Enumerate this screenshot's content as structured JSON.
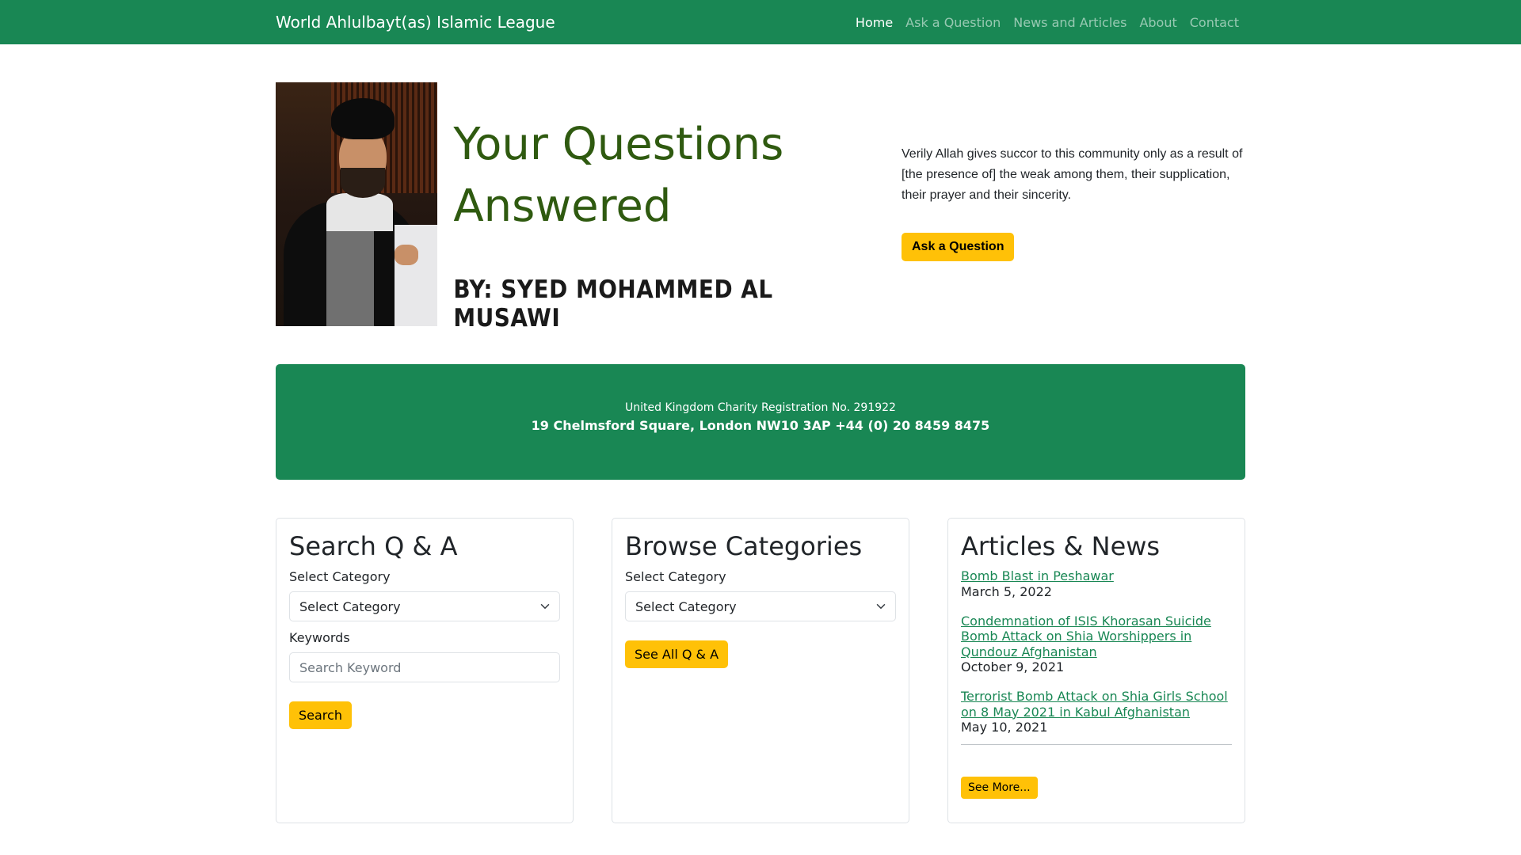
{
  "nav": {
    "brand": "World Ahlulbayt(as) Islamic League",
    "links": [
      "Home",
      "Ask a Question",
      "News and Articles",
      "About",
      "Contact"
    ]
  },
  "hero": {
    "title_line1": "Your Questions",
    "title_line2": "Answered",
    "byline": "BY: SYED MOHAMMED AL MUSAWI",
    "quote": "Verily Allah gives succor to this community only as a result of [the presence of] the weak among them, their supplication, their prayer and their sincerity.",
    "ask_button": "Ask a Question"
  },
  "info": {
    "registration": "United Kingdom Charity Registration No. 291922",
    "address": "19 Chelmsford Square, London NW10 3AP +44 (0) 20 8459 8475"
  },
  "search_card": {
    "title": "Search Q & A",
    "category_label": "Select Category",
    "category_value": "Select Category",
    "keywords_label": "Keywords",
    "keyword_placeholder": "Search Keyword",
    "button": "Search"
  },
  "browse_card": {
    "title": "Browse Categories",
    "category_label": "Select Category",
    "category_value": "Select Category",
    "button": "See All Q & A"
  },
  "news_card": {
    "title": "Articles & News",
    "articles": [
      {
        "title": "Bomb Blast in Peshawar",
        "date": "March 5, 2022"
      },
      {
        "title": "Condemnation of ISIS Khorasan Suicide Bomb Attack on Shia Worshippers in Qundouz Afghanistan",
        "date": "October 9, 2021"
      },
      {
        "title": "Terrorist Bomb Attack on Shia Girls School on 8 May 2021 in Kabul Afghanistan",
        "date": "May 10, 2021"
      }
    ],
    "more_button": "See More..."
  },
  "colors": {
    "primary_green": "#198754",
    "accent_yellow": "#ffc107",
    "title_green": "#2f5a10"
  }
}
